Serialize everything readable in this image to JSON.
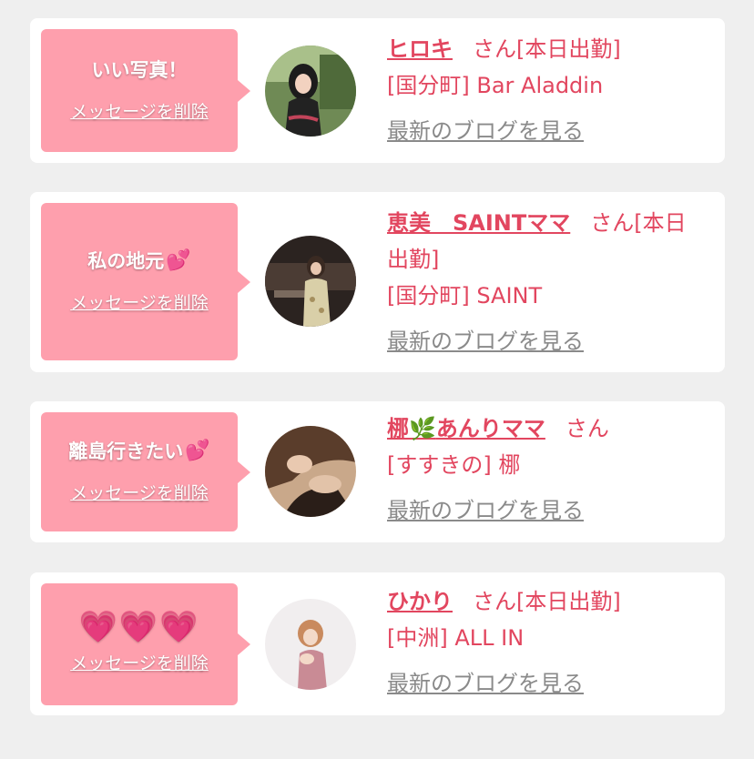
{
  "common": {
    "delete_label": "メッセージを削除",
    "san": "さん",
    "blog_link": "最新のブログを見る"
  },
  "items": [
    {
      "message": "いい写真！",
      "message_emoji": "",
      "name": "ヒロキ",
      "status": "[本日出勤]",
      "shop": "[国分町] Bar Aladdin"
    },
    {
      "message": "私の地元",
      "message_emoji": "💕",
      "name": "恵美　SAINTママ",
      "status": "[本日出勤]",
      "shop": "[国分町] SAINT"
    },
    {
      "message": "離島行きたい",
      "message_emoji": "💕",
      "name_part1": "梛",
      "name_emoji": "🌿",
      "name_part2": "あんりママ",
      "status": "",
      "shop": "[すすきの] 梛"
    },
    {
      "message": "💗💗💗",
      "name": "ひかり",
      "status": "[本日出勤]",
      "shop": "[中洲] ALL IN"
    }
  ],
  "colors": {
    "background": "#efefef",
    "card": "#ffffff",
    "bubble": "#fe9fad",
    "accent_text": "#e2465f",
    "link_gray": "#8a8a8a"
  }
}
